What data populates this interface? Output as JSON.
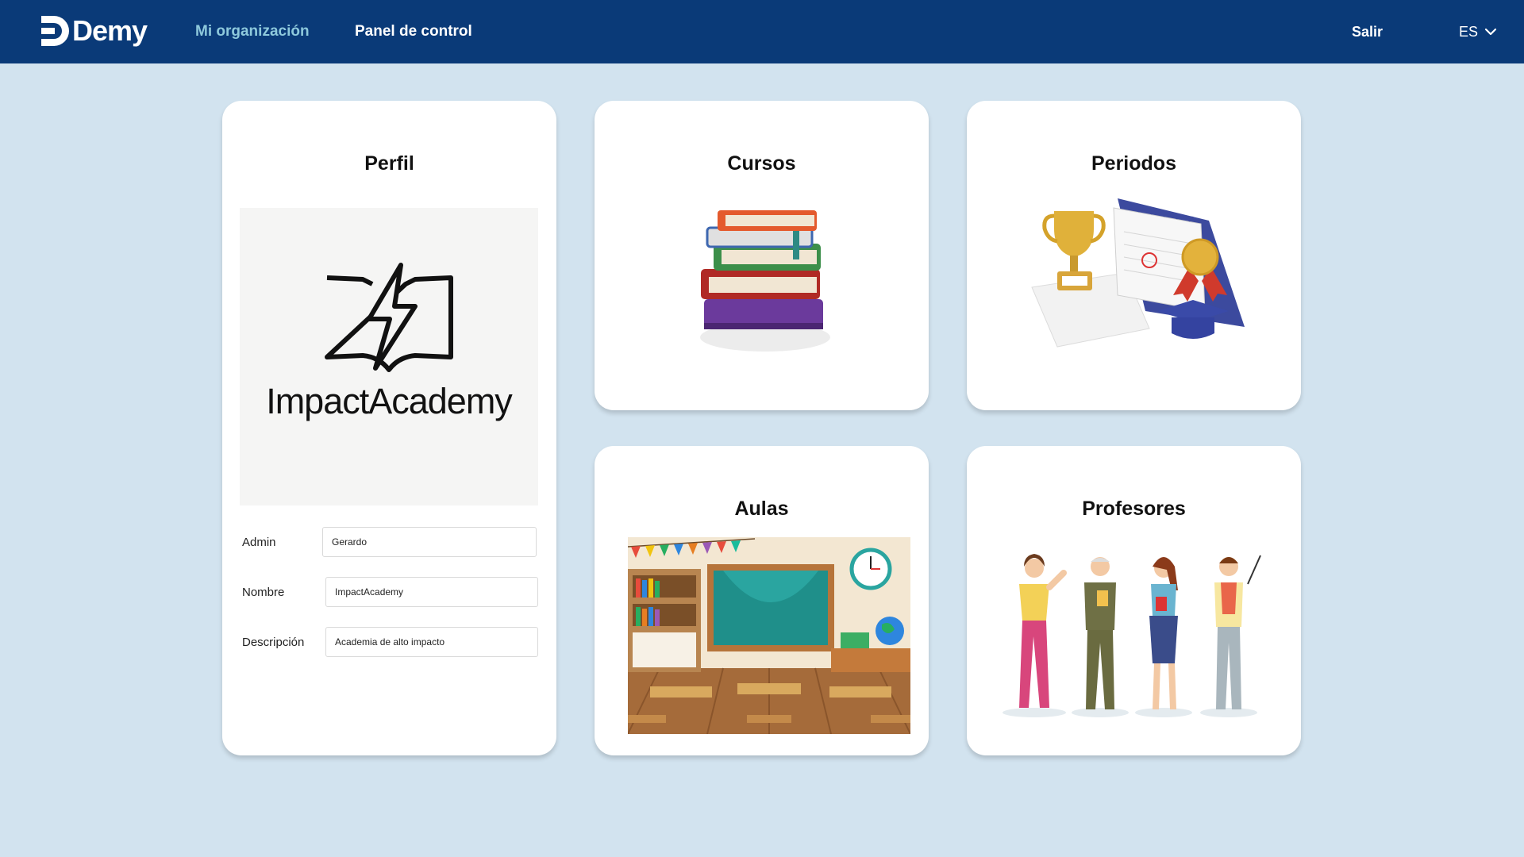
{
  "brand": {
    "name": "Demy"
  },
  "nav": {
    "my_org": "Mi organización",
    "control_panel": "Panel de control",
    "exit": "Salir",
    "language": "ES"
  },
  "profile": {
    "title": "Perfil",
    "org_logo_text": "ImpactAcademy",
    "fields": {
      "admin_label": "Admin",
      "admin_value": "Gerardo",
      "name_label": "Nombre",
      "name_value": "ImpactAcademy",
      "description_label": "Descripción",
      "description_value": "Academia de alto impacto"
    }
  },
  "cards": {
    "courses": "Cursos",
    "periods": "Periodos",
    "classrooms": "Aulas",
    "teachers": "Profesores"
  },
  "colors": {
    "topbar": "#0a3a78",
    "active_nav": "#8ec9dc",
    "background": "#d2e3ef"
  }
}
